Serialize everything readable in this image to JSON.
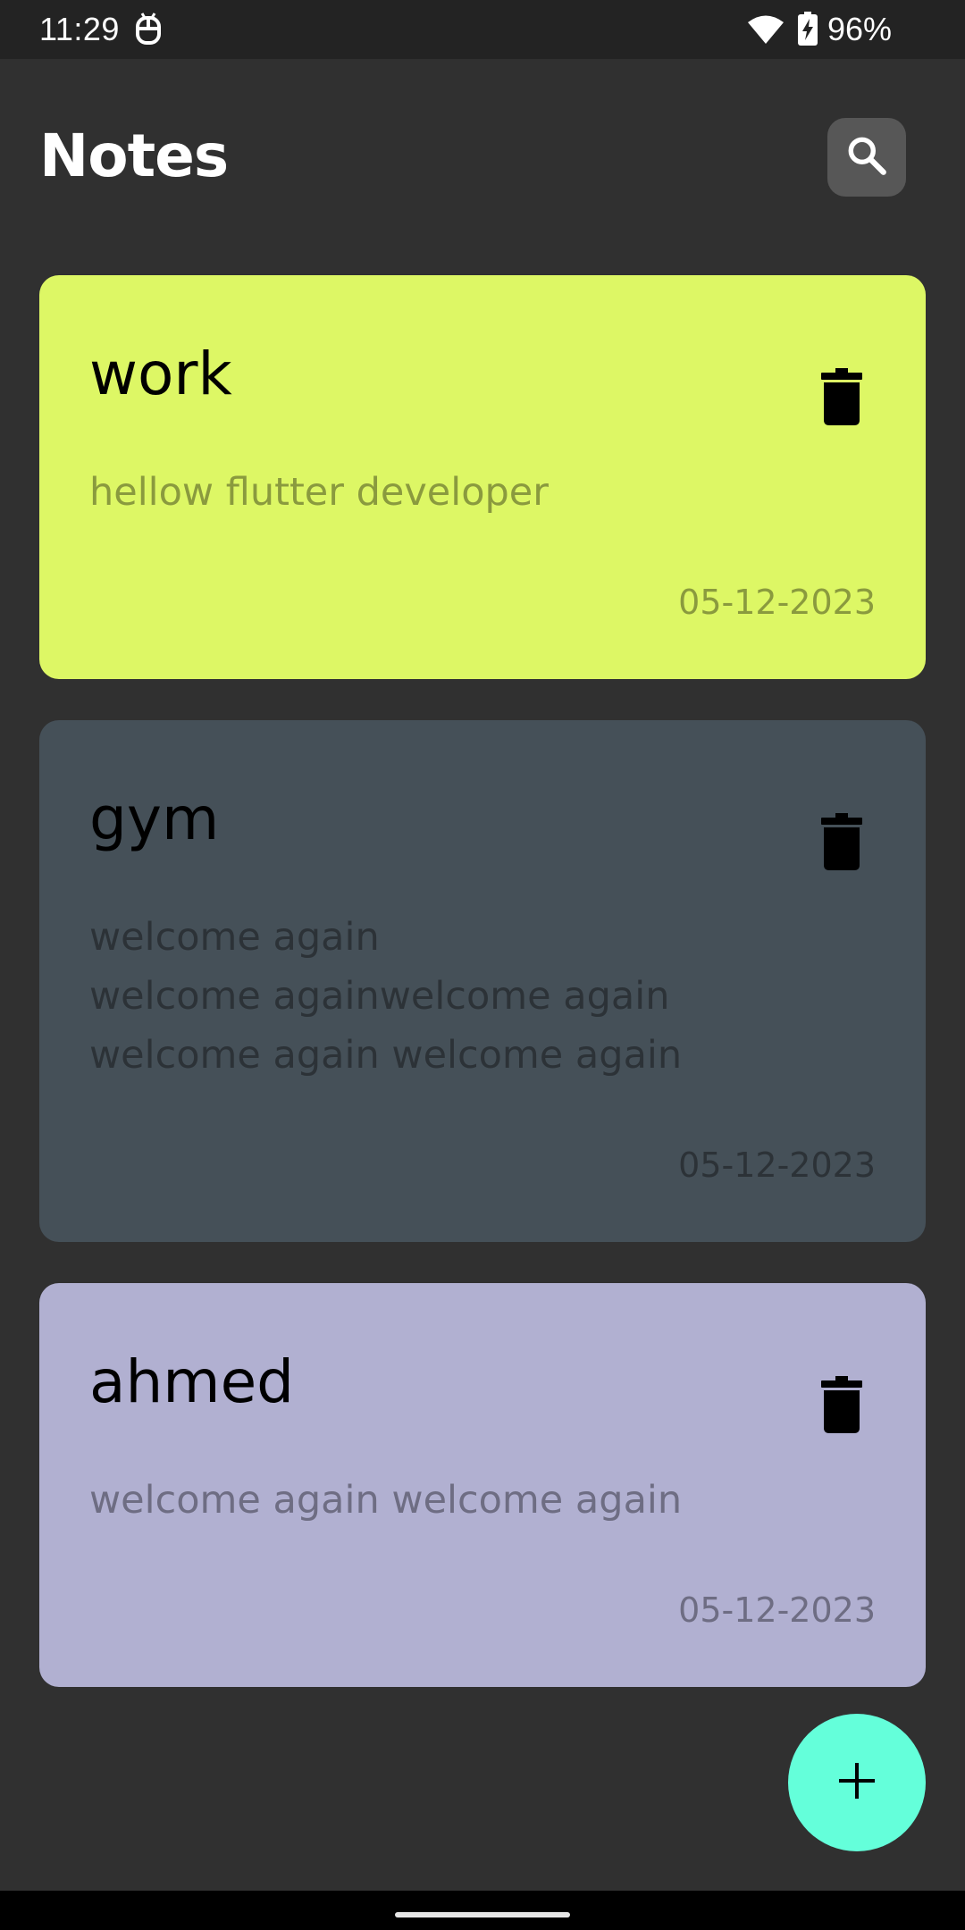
{
  "status_bar": {
    "time": "11:29",
    "notification_icon": "android-debug-icon",
    "wifi_icon": "wifi-icon",
    "battery_icon": "battery-charging-icon",
    "battery_percent": "96%"
  },
  "header": {
    "title": "Notes",
    "search_icon": "search-icon"
  },
  "notes": [
    {
      "title": "work",
      "body": [
        "hellow flutter developer"
      ],
      "date": "05-12-2023",
      "background": "#ddf765",
      "body_color": "#8a9a3e",
      "date_color": "#8a9a3e"
    },
    {
      "title": "gym",
      "body": [
        "welcome again",
        "welcome againwelcome again",
        "welcome again welcome again"
      ],
      "date": "05-12-2023",
      "background": "#455058",
      "body_color": "#2c3237",
      "date_color": "#2c3237"
    },
    {
      "title": "ahmed",
      "body": [
        "welcome again welcome again"
      ],
      "date": "05-12-2023",
      "background": "#b1b0d1",
      "body_color": "#6e6d83",
      "date_color": "#6e6d83"
    }
  ],
  "fab": {
    "icon": "plus-icon",
    "color": "#64ffda"
  },
  "colors": {
    "background": "#303030",
    "status_bar": "#232323",
    "search_button": "#575757"
  }
}
